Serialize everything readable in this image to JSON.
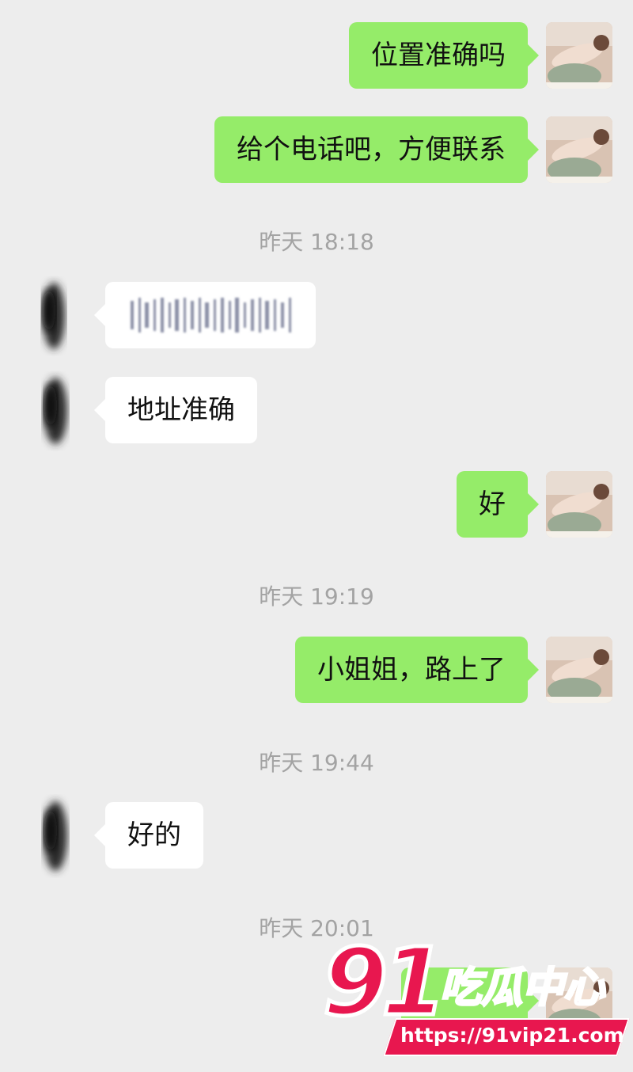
{
  "colors": {
    "background": "#ededed",
    "outgoing_bubble": "#95ec69",
    "incoming_bubble": "#ffffff",
    "timestamp_text": "#a3a3a3",
    "watermark_accent": "#e8174f"
  },
  "messages": [
    {
      "side": "out",
      "text": "位置准确吗"
    },
    {
      "side": "out",
      "text": "给个电话吧，方便联系"
    },
    {
      "timestamp": "昨天 18:18"
    },
    {
      "side": "in",
      "text": "",
      "content": "redacted-text"
    },
    {
      "side": "in",
      "text": "地址准确"
    },
    {
      "side": "out",
      "text": "好"
    },
    {
      "timestamp": "昨天 19:19"
    },
    {
      "side": "out",
      "text": "小姐姐，路上了"
    },
    {
      "timestamp": "昨天 19:44"
    },
    {
      "side": "in",
      "text": "好的"
    },
    {
      "timestamp": "昨天 20:01"
    },
    {
      "side": "out",
      "text": "",
      "content": "obscured-by-watermark"
    }
  ],
  "avatars": {
    "self": "photo-avatar-icon",
    "contact": "blurred-avatar-icon"
  },
  "watermark": {
    "number": "91",
    "name": "吃瓜中心",
    "url": "https://91vip21.com"
  }
}
